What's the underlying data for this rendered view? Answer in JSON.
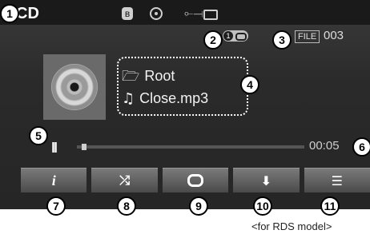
{
  "header": {
    "source_label": "CD",
    "bluetooth_icon": "bluetooth-icon",
    "disc_icon": "disc-icon",
    "usb_icon": "usb-icon",
    "aux_icon": "aux-plug-icon"
  },
  "status": {
    "repeat_badge_one": "1",
    "file_label": "FILE",
    "file_number": "003"
  },
  "track": {
    "folder": "Root",
    "filename": "Close.mp3",
    "elapsed": "00:05",
    "progress_fraction": 0.02
  },
  "controls": {
    "pause_symbol": "II",
    "info_label": "i",
    "shuffle_icon": "shuffle-icon",
    "repeat_icon": "repeat-icon",
    "save_icon": "save-icon",
    "list_icon": "list-icon"
  },
  "callouts": [
    "1",
    "2",
    "3",
    "4",
    "5",
    "6",
    "7",
    "8",
    "9",
    "10",
    "11"
  ],
  "caption": "<for RDS model>"
}
